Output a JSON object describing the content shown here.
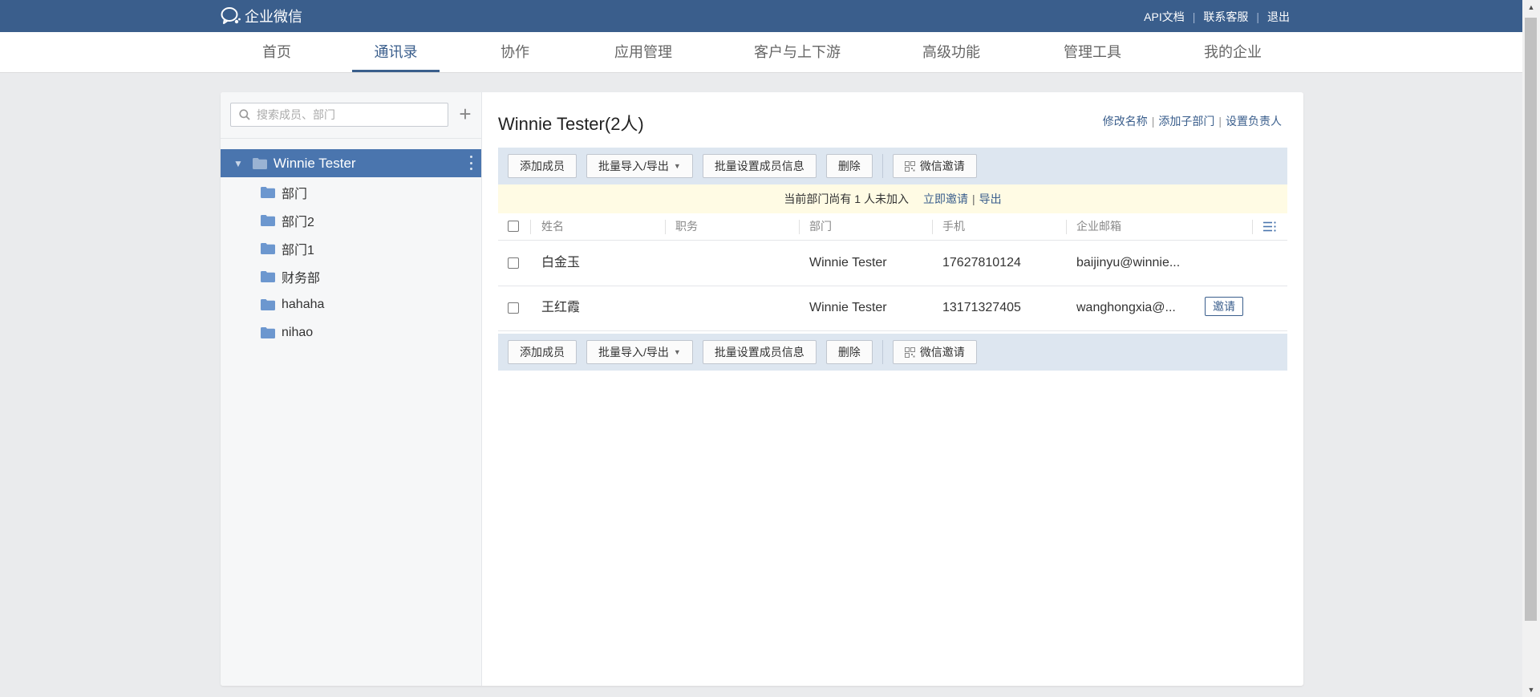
{
  "brand": {
    "name": "企业微信"
  },
  "top_links": [
    "API文档",
    "联系客服",
    "退出"
  ],
  "nav": {
    "items": [
      "首页",
      "通讯录",
      "协作",
      "应用管理",
      "客户与上下游",
      "高级功能",
      "管理工具",
      "我的企业"
    ],
    "active": "通讯录"
  },
  "sidebar": {
    "search_placeholder": "搜索成员、部门",
    "add_label": "+",
    "root": "Winnie Tester",
    "departments": [
      "部门",
      "部门2",
      "部门1",
      "财务部",
      "hahaha",
      "nihao"
    ]
  },
  "main": {
    "title": "Winnie Tester(2人)",
    "actions": [
      "修改名称",
      "添加子部门",
      "设置负责人"
    ],
    "toolbar": {
      "add_member": "添加成员",
      "import_export": "批量导入/导出",
      "batch_set": "批量设置成员信息",
      "delete": "删除",
      "wechat_invite": "微信邀请"
    },
    "notice": {
      "text": "当前部门尚有 1 人未加入",
      "invite_now": "立即邀请",
      "export": "导出"
    },
    "table": {
      "columns": [
        "姓名",
        "职务",
        "部门",
        "手机",
        "企业邮箱"
      ],
      "rows": [
        {
          "name": "白金玉",
          "position": "",
          "department": "Winnie Tester",
          "phone": "17627810124",
          "email": "baijinyu@winnie...",
          "action": ""
        },
        {
          "name": "王红霞",
          "position": "",
          "department": "Winnie Tester",
          "phone": "13171327405",
          "email": "wanghongxia@...",
          "action": "邀请"
        }
      ]
    }
  },
  "colors": {
    "topbar": "#3a5e8c",
    "accent": "#3a5e8c",
    "selected_tree": "#4a75ae",
    "toolbar_bg": "#dde6f0",
    "notice_bg": "#fffbe4"
  }
}
